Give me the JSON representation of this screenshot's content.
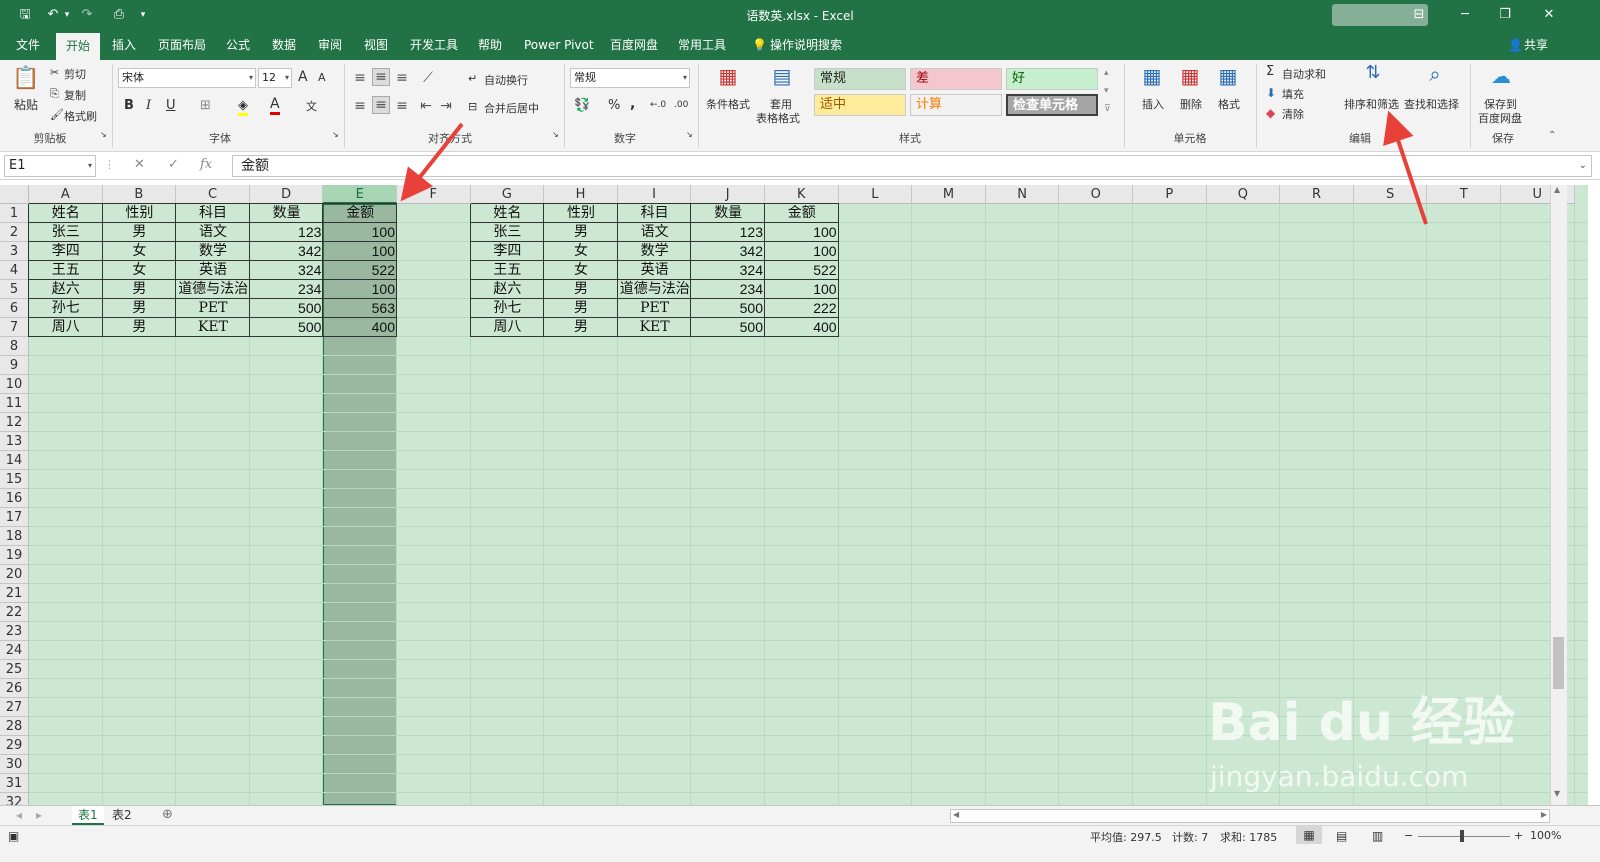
{
  "window": {
    "title": "语数英.xlsx  -  Excel",
    "minimize": "─",
    "restore": "❐",
    "close": "✕",
    "ribbon_display": "⊟"
  },
  "qat": {
    "save": "🖫",
    "undo": "↶",
    "redo": "↷",
    "preview": "⎙",
    "customize": "▾"
  },
  "tabs": [
    "文件",
    "开始",
    "插入",
    "页面布局",
    "公式",
    "数据",
    "审阅",
    "视图",
    "开发工具",
    "帮助",
    "Power Pivot",
    "百度网盘",
    "常用工具"
  ],
  "active_tab": "开始",
  "tell_me": "操作说明搜索",
  "share": "共享",
  "ribbon": {
    "clipboard": {
      "label": "剪贴板",
      "paste": "粘贴",
      "cut": "剪切",
      "copy": "复制",
      "format_painter": "格式刷"
    },
    "font": {
      "label": "字体",
      "name": "宋体",
      "size": "12",
      "bold": "B",
      "italic": "I",
      "underline": "U",
      "grow": "A",
      "shrink": "A",
      "font_color": "A"
    },
    "alignment": {
      "label": "对齐方式",
      "wrap": "自动换行",
      "merge": "合并后居中"
    },
    "number": {
      "label": "数字",
      "format": "常规",
      "percent": "%",
      "comma": ",",
      "inc": "←.0",
      "dec": ".00"
    },
    "styles": {
      "label": "样式",
      "conditional": "条件格式",
      "table_line1": "套用",
      "table_line2": "表格格式",
      "cells": [
        {
          "text": "常规",
          "bg": "#c6e0c9",
          "fg": "#222222"
        },
        {
          "text": "差",
          "bg": "#f4c7ce",
          "fg": "#9c0006"
        },
        {
          "text": "好",
          "bg": "#c6efce",
          "fg": "#006100"
        },
        {
          "text": "适中",
          "bg": "#ffeb9c",
          "fg": "#9c5700"
        },
        {
          "text": "计算",
          "bg": "#f2f2f2",
          "fg": "#fa7d00"
        },
        {
          "text": "检查单元格",
          "bg": "#a5a5a5",
          "fg": "#ffffff"
        }
      ]
    },
    "cells_group": {
      "label": "单元格",
      "insert": "插入",
      "delete": "删除",
      "format": "格式"
    },
    "editing": {
      "label": "编辑",
      "autosum": "自动求和",
      "fill": "填充",
      "clear": "清除",
      "sort_filter": "排序和筛选",
      "find": "查找和选择"
    },
    "save": {
      "label": "保存",
      "line1": "保存到",
      "line2": "百度网盘"
    }
  },
  "formula_bar": {
    "name_box": "E1",
    "cancel": "✕",
    "enter": "✓",
    "fx": "fx",
    "content": "金额"
  },
  "columns": [
    "A",
    "B",
    "C",
    "D",
    "E",
    "F",
    "G",
    "H",
    "I",
    "J",
    "K",
    "L",
    "M",
    "N",
    "O",
    "P",
    "Q",
    "R",
    "S",
    "T",
    "U"
  ],
  "selected_column": "E",
  "rows": [
    "1",
    "2",
    "3",
    "4",
    "5",
    "6",
    "7",
    "8",
    "9",
    "10",
    "11",
    "12",
    "13",
    "14",
    "15",
    "16",
    "17",
    "18",
    "19",
    "20",
    "21",
    "22",
    "23",
    "24",
    "25",
    "26",
    "27",
    "28",
    "29",
    "30",
    "31",
    "32"
  ],
  "table_left": {
    "header": [
      "姓名",
      "性别",
      "科目",
      "数量",
      "金额"
    ],
    "rows": [
      [
        "张三",
        "男",
        "语文",
        "123",
        "100"
      ],
      [
        "李四",
        "女",
        "数学",
        "342",
        "100"
      ],
      [
        "王五",
        "女",
        "英语",
        "324",
        "522"
      ],
      [
        "赵六",
        "男",
        "道德与法治",
        "234",
        "100"
      ],
      [
        "孙七",
        "男",
        "PET",
        "500",
        "563"
      ],
      [
        "周八",
        "男",
        "KET",
        "500",
        "400"
      ]
    ]
  },
  "table_right": {
    "header": [
      "姓名",
      "性别",
      "科目",
      "数量",
      "金额"
    ],
    "rows": [
      [
        "张三",
        "男",
        "语文",
        "123",
        "100"
      ],
      [
        "李四",
        "女",
        "数学",
        "342",
        "100"
      ],
      [
        "王五",
        "女",
        "英语",
        "324",
        "522"
      ],
      [
        "赵六",
        "男",
        "道德与法治",
        "234",
        "100"
      ],
      [
        "孙七",
        "男",
        "PET",
        "500",
        "222"
      ],
      [
        "周八",
        "男",
        "KET",
        "500",
        "400"
      ]
    ]
  },
  "sheets": [
    "表1",
    "表2"
  ],
  "active_sheet": "表1",
  "status": {
    "average": "平均值: 297.5",
    "count": "计数: 7",
    "sum": "求和: 1785",
    "zoom": "100%"
  },
  "watermark": {
    "line1": "Bai du 经验",
    "line2": "jingyan.baidu.com"
  },
  "colors": {
    "accent": "#217346",
    "cell_bg": "#cde8d2",
    "arrow": "#e8413a"
  }
}
